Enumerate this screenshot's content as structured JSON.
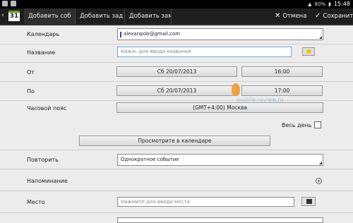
{
  "statusbar": {
    "battery": "80%",
    "time": "15:48"
  },
  "actionbar": {
    "tabs": [
      "Добавить соб",
      "Добавить зад",
      "Добавить зам"
    ],
    "calendar_day": "31",
    "cancel_label": "Отмена",
    "save_label": "Сохранить"
  },
  "form": {
    "calendar": {
      "label": "Календарь",
      "value": "alexanpob@gmail.com"
    },
    "title": {
      "label": "Название",
      "placeholder": "Нажм. для ввода названия"
    },
    "from": {
      "label": "От",
      "date": "Сб 20/07/2013",
      "time": "16:00"
    },
    "to": {
      "label": "По",
      "date": "Сб 20/07/2013",
      "time": "17:00"
    },
    "timezone": {
      "label": "Часовой пояс",
      "value": "(GMT+4:00) Москва"
    },
    "allday": {
      "label": "Весь день",
      "checked": false
    },
    "view_in_calendar": "Просмотрите в календаре",
    "repeat": {
      "label": "Повторить",
      "value": "Однократное событие"
    },
    "reminder": {
      "label": "Напоминание"
    },
    "location": {
      "label": "Место",
      "placeholder": "Нажмите для ввода места"
    }
  },
  "watermark_text": "mobile-review.ru"
}
